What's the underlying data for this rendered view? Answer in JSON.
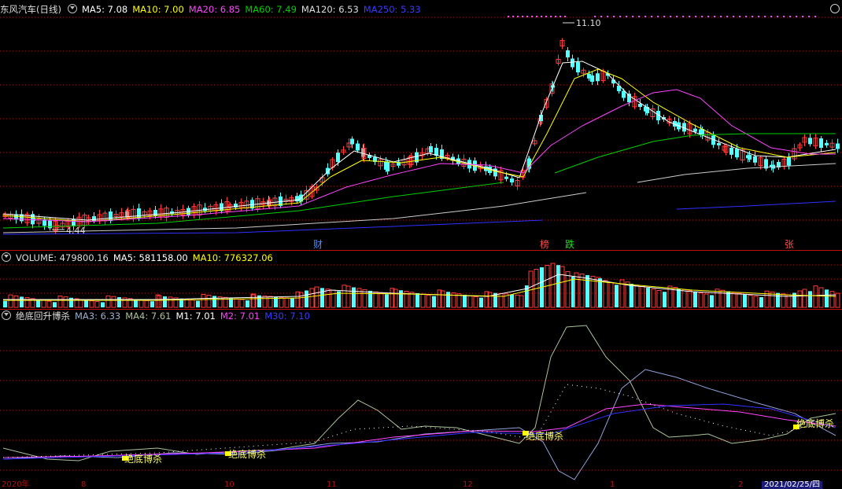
{
  "main_header": {
    "stock": "东风汽车(日线)",
    "ma5": "MA5: 7.08",
    "ma10": "MA10: 7.00",
    "ma20": "MA20: 6.85",
    "ma60": "MA60: 7.49",
    "ma120": "MA120: 6.53",
    "ma250": "MA250: 5.33"
  },
  "annotations": {
    "high": "11.10",
    "low": "4.44"
  },
  "event_marks": [
    "财",
    "榜",
    "跌",
    "张"
  ],
  "volume_header": {
    "name": "VOLUME: 479800.16",
    "ma5": "MA5: 581158.00",
    "ma10": "MA10: 776327.06"
  },
  "indicator_header": {
    "name": "绝底回升博杀",
    "ma3": "MA3: 6.33",
    "ma4": "MA4: 7.61",
    "m1": "M1: 7.01",
    "m2": "M2: 7.01",
    "m30": "M30: 7.10"
  },
  "signal_label": "绝底博杀",
  "x_axis": {
    "start": "2020年",
    "ticks": [
      "8",
      "10",
      "11",
      "12",
      "1",
      "2"
    ],
    "current_date": "2021/02/25/四"
  },
  "colors": {
    "up": "#ff3c3c",
    "down": "#54ffff",
    "ma5": "#ffffff",
    "ma10": "#ffff00",
    "ma20": "#ff44ff",
    "ma60": "#00d000",
    "ma120": "#cccccc",
    "ma250": "#3030ff",
    "grid": "#b01010"
  }
}
